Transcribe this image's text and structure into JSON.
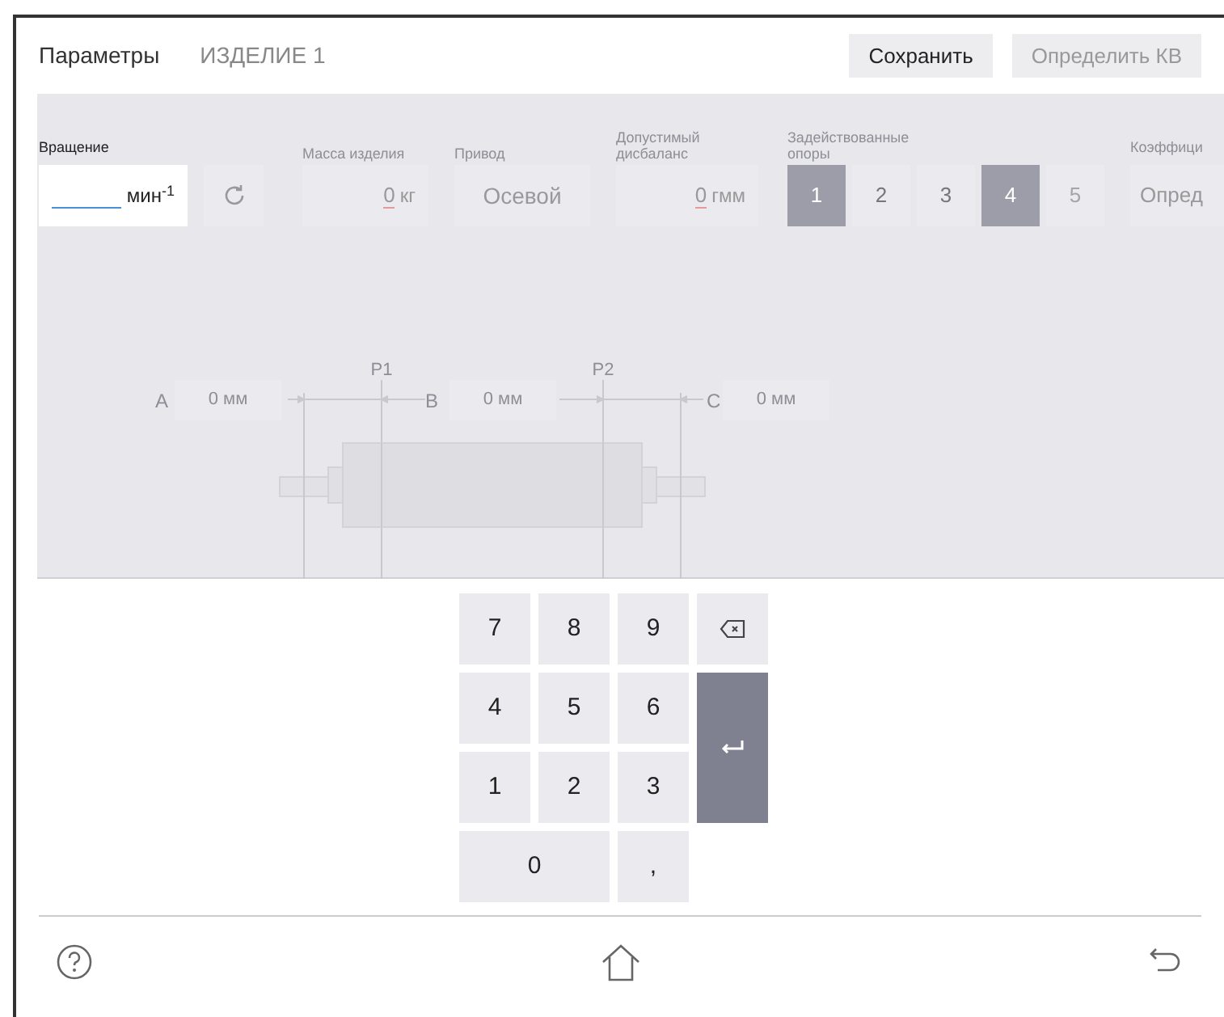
{
  "header": {
    "title": "Параметры",
    "product": "ИЗДЕЛИЕ 1",
    "buttons": [
      {
        "label": "Сохранить",
        "disabled": false
      },
      {
        "label": "Определить КВ",
        "disabled": true
      }
    ]
  },
  "form": {
    "rotation": {
      "label": "Вращение",
      "unit": "мин$^{-1}$"
    },
    "fields": [
      {
        "kind": "number",
        "label": "Масса изделия",
        "value": "0",
        "unit": "кг",
        "disabled": true
      },
      {
        "kind": "select",
        "label": "Привод",
        "value": "Осевой",
        "disabled": true
      },
      {
        "kind": "number",
        "label": "Допустимый дисбаланс",
        "value": "0",
        "unit": "гмм",
        "disabled": true
      }
    ],
    "supports": {
      "label": "Задействованные опоры",
      "items": [
        {
          "label": "1",
          "selected": true,
          "disabled": false
        },
        {
          "label": "2",
          "selected": false,
          "disabled": false
        },
        {
          "label": "3",
          "selected": false,
          "disabled": false
        },
        {
          "label": "4",
          "selected": true,
          "disabled": false
        },
        {
          "label": "5",
          "selected": false,
          "disabled": true
        }
      ]
    },
    "coefficient": {
      "label": "Коэффици",
      "value": "Опред"
    }
  },
  "diagram": {
    "distances": [
      {
        "label": "A",
        "value": "0 мм"
      },
      {
        "label": "B",
        "value": "0 мм"
      },
      {
        "label": "C",
        "value": "0 мм"
      }
    ],
    "planes": [
      "P1",
      "P2"
    ]
  },
  "keypad": [
    {
      "kind": "digit",
      "label": "7"
    },
    {
      "kind": "digit",
      "label": "8"
    },
    {
      "kind": "digit",
      "label": "9"
    },
    {
      "kind": "backspace"
    },
    {
      "kind": "digit",
      "label": "4"
    },
    {
      "kind": "digit",
      "label": "5"
    },
    {
      "kind": "digit",
      "label": "6"
    },
    {
      "kind": "enter"
    },
    {
      "kind": "digit",
      "label": "1"
    },
    {
      "kind": "digit",
      "label": "2"
    },
    {
      "kind": "digit",
      "label": "3"
    },
    {
      "kind": "wide",
      "label": "0"
    },
    {
      "kind": "digit",
      "label": ","
    }
  ]
}
